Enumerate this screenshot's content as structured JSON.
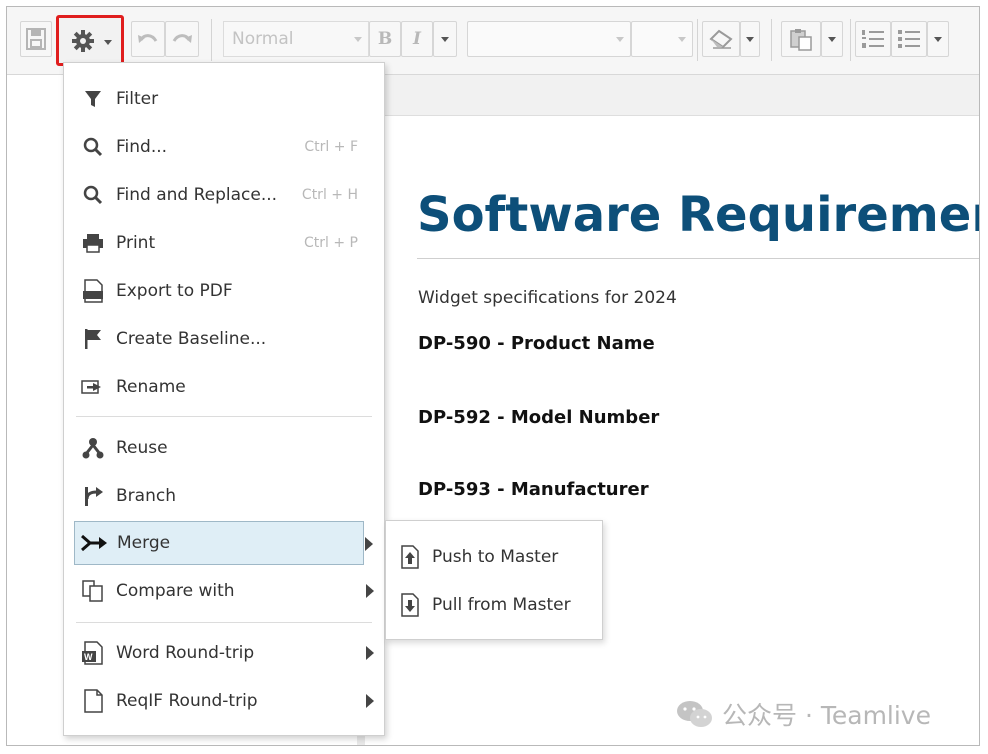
{
  "toolbar": {
    "style_select_value": "Normal",
    "buttons": [
      "save-icon",
      "gear-icon",
      "undo-icon",
      "redo-icon",
      "bold-icon",
      "italic-icon",
      "eraser-icon",
      "paste-icon",
      "numbered-list-icon",
      "bulleted-list-icon"
    ],
    "bold_glyph": "B",
    "italic_glyph": "I"
  },
  "settings_menu": {
    "items": [
      {
        "label": "Filter",
        "icon": "filter-icon"
      },
      {
        "label": "Find...",
        "icon": "search-icon",
        "shortcut": "Ctrl + F"
      },
      {
        "label": "Find and Replace...",
        "icon": "search-icon",
        "shortcut": "Ctrl + H"
      },
      {
        "label": "Print",
        "icon": "printer-icon",
        "shortcut": "Ctrl + P"
      },
      {
        "label": "Export to PDF",
        "icon": "pdf-icon"
      },
      {
        "label": "Create Baseline...",
        "icon": "flag-icon"
      },
      {
        "label": "Rename",
        "icon": "rename-icon"
      },
      {
        "label": "Reuse",
        "icon": "reuse-icon"
      },
      {
        "label": "Branch",
        "icon": "branch-icon"
      },
      {
        "label": "Merge",
        "icon": "merge-icon",
        "highlighted": true
      },
      {
        "label": "Compare with",
        "icon": "compare-icon"
      },
      {
        "label": "Word Round-trip",
        "icon": "word-icon"
      },
      {
        "label": "ReqIF Round-trip",
        "icon": "document-icon"
      }
    ]
  },
  "merge_submenu": {
    "items": [
      {
        "label": "Push to Master",
        "icon": "push-icon"
      },
      {
        "label": "Pull from Master",
        "icon": "pull-icon"
      }
    ]
  },
  "document": {
    "title": "Software Requirement",
    "subtitle": "Widget specifications for 2024",
    "requirements": [
      "DP-590 - Product Name",
      "DP-592 - Model Number",
      "DP-593 - Manufacturer"
    ]
  },
  "watermark": {
    "text": "公众号 · Teamlive"
  },
  "colors": {
    "title": "#0d4f79",
    "highlight_border": "#e01e1e",
    "menu_active_bg": "#dfeef6"
  }
}
